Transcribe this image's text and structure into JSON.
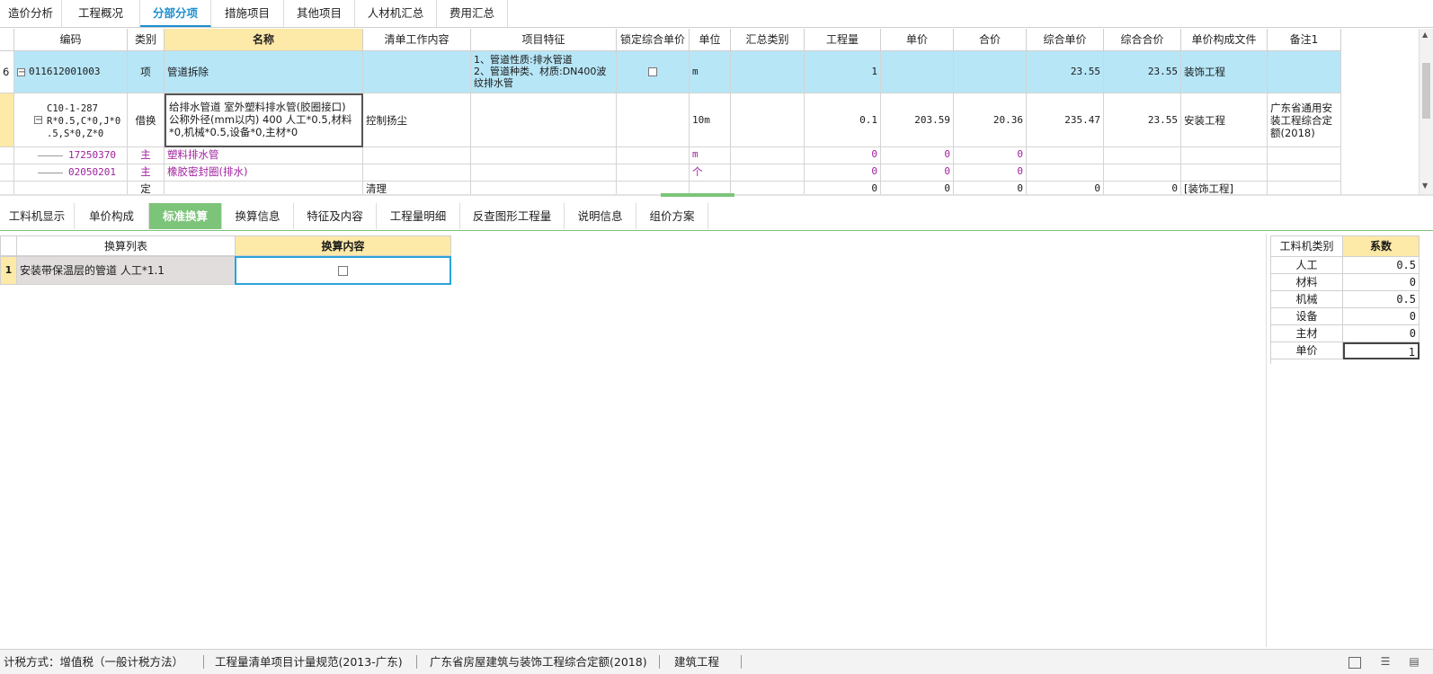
{
  "top_tabs": [
    "造价分析",
    "工程概况",
    "分部分项",
    "措施项目",
    "其他项目",
    "人材机汇总",
    "费用汇总"
  ],
  "active_top_tab": "分部分项",
  "grid": {
    "headers": [
      "编码",
      "类别",
      "名称",
      "清单工作内容",
      "项目特征",
      "锁定综合单价",
      "单位",
      "汇总类别",
      "工程量",
      "单价",
      "合价",
      "综合单价",
      "综合合价",
      "单价构成文件",
      "备注1"
    ],
    "rows": [
      {
        "row_no": "6",
        "code": "011612001003",
        "type": "项",
        "name": "管道拆除",
        "work": "",
        "feature": "1、管道性质:排水管道\n2、管道种类、材质:DN400波纹排水管",
        "locked": false,
        "unit": "m",
        "sum_cat": "",
        "qty": "1",
        "price": "",
        "total": "",
        "comp_price": "23.55",
        "comp_total": "23.55",
        "file": "装饰工程",
        "note": ""
      },
      {
        "row_no": "",
        "code": "C10-1-287\nR*0.5,C*0,J*0\n.5,S*0,Z*0",
        "type": "借换",
        "name": "给排水管道 室外塑料排水管(胶圈接口) 公称外径(mm以内) 400  人工*0.5,材料*0,机械*0.5,设备*0,主材*0",
        "work": "控制扬尘",
        "feature": "",
        "unit": "10m",
        "sum_cat": "",
        "qty": "0.1",
        "price": "203.59",
        "total": "20.36",
        "comp_price": "235.47",
        "comp_total": "23.55",
        "file": "安装工程",
        "note": "广东省通用安装工程综合定额(2018)"
      },
      {
        "code": "17250370",
        "type": "主",
        "name": "塑料排水管",
        "unit": "m",
        "qty": "0",
        "price": "0",
        "total": "0"
      },
      {
        "code": "02050201",
        "type": "主",
        "name": "橡胶密封圈(排水)",
        "unit": "个",
        "qty": "0",
        "price": "0",
        "total": "0"
      },
      {
        "code": "",
        "type": "定",
        "name": "",
        "work": "清理",
        "qty": "0",
        "price": "0",
        "total": "0",
        "comp_price": "0",
        "comp_total": "0",
        "file": "[装饰工程]"
      }
    ]
  },
  "bottom_tabs": [
    "工料机显示",
    "单价构成",
    "标准换算",
    "换算信息",
    "特征及内容",
    "工程量明细",
    "反查图形工程量",
    "说明信息",
    "组价方案"
  ],
  "active_bottom_tab": "标准换算",
  "conversion": {
    "headers": [
      "换算列表",
      "换算内容"
    ],
    "rows": [
      {
        "no": "1",
        "item": "安装带保温层的管道 人工*1.1",
        "checked": false
      }
    ]
  },
  "coefficients": {
    "headers": [
      "工料机类别",
      "系数"
    ],
    "rows": [
      {
        "cat": "人工",
        "val": "0.5"
      },
      {
        "cat": "材料",
        "val": "0"
      },
      {
        "cat": "机械",
        "val": "0.5"
      },
      {
        "cat": "设备",
        "val": "0"
      },
      {
        "cat": "主材",
        "val": "0"
      },
      {
        "cat": "单价",
        "val": "1"
      }
    ]
  },
  "status_bar": {
    "tax": "计税方式：增值税（一般计税方法）",
    "spec": "工程量清单项目计量规范(2013-广东)",
    "quota": "广东省房屋建筑与装饰工程综合定额(2018)",
    "type": "建筑工程"
  },
  "colors": {
    "accent": "#1d8fd0",
    "selection": "#b7e6f7",
    "header_selected": "#fde9a8",
    "green": "#7cc47a",
    "purple": "#a0219e"
  }
}
